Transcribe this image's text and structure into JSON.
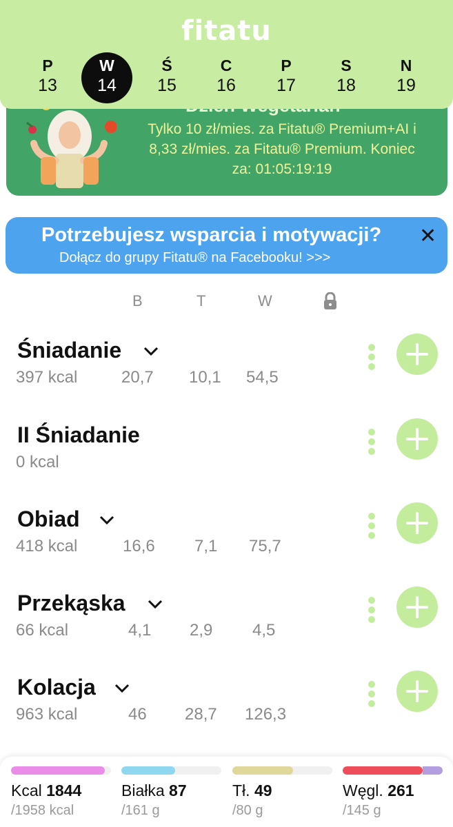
{
  "header": {
    "logo": "fitatu",
    "days": [
      {
        "letter": "P",
        "num": "13",
        "active": false
      },
      {
        "letter": "W",
        "num": "14",
        "active": true
      },
      {
        "letter": "Ś",
        "num": "15",
        "active": false
      },
      {
        "letter": "C",
        "num": "16",
        "active": false
      },
      {
        "letter": "P",
        "num": "17",
        "active": false
      },
      {
        "letter": "S",
        "num": "18",
        "active": false
      },
      {
        "letter": "N",
        "num": "19",
        "active": false
      }
    ]
  },
  "promo": {
    "title": "Dzień Wegetarian",
    "line1": "Tylko 10 zł/mies. za Fitatu® Premium+AI i",
    "line2": "8,33 zł/mies. za Fitatu® Premium. Koniec",
    "line3": "za: 01:05:19:19"
  },
  "facebook": {
    "title": "Potrzebujesz wsparcia i motywacji?",
    "subtitle": "Dołącz do grupy Fitatu® na Facebooku! >>>",
    "close": "✕"
  },
  "columns": {
    "b": "B",
    "t": "T",
    "w": "W",
    "lock_icon": "lock-icon"
  },
  "meals": [
    {
      "name": "Śniadanie",
      "kcal": "397 kcal",
      "b": "20,7",
      "t": "10,1",
      "w": "54,5"
    },
    {
      "name": "II Śniadanie",
      "kcal": "0 kcal",
      "b": "",
      "t": "",
      "w": ""
    },
    {
      "name": "Obiad",
      "kcal": "418 kcal",
      "b": "16,6",
      "t": "7,1",
      "w": "75,7"
    },
    {
      "name": "Przekąska",
      "kcal": "66 kcal",
      "b": "4,1",
      "t": "2,9",
      "w": "4,5"
    },
    {
      "name": "Kolacja",
      "kcal": "963 kcal",
      "b": "46",
      "t": "28,7",
      "w": "126,3"
    }
  ],
  "summary": {
    "kcal": {
      "label": "Kcal",
      "value": "1844",
      "goal": "/1958 kcal",
      "progress": 0.94,
      "color": "#e98de8"
    },
    "protein": {
      "label": "Białka",
      "value": "87",
      "goal": "/161 g",
      "progress": 0.54,
      "color": "#8fd6ef"
    },
    "fat": {
      "label": "Tł.",
      "value": "49",
      "goal": "/80 g",
      "progress": 0.61,
      "color": "#e0d79a"
    },
    "carbs": {
      "label": "Węgl.",
      "value": "261",
      "goal": "/145 g",
      "progress": 1.0,
      "color": "#ee4d5a",
      "overflow_color": "#b39ee0"
    }
  }
}
